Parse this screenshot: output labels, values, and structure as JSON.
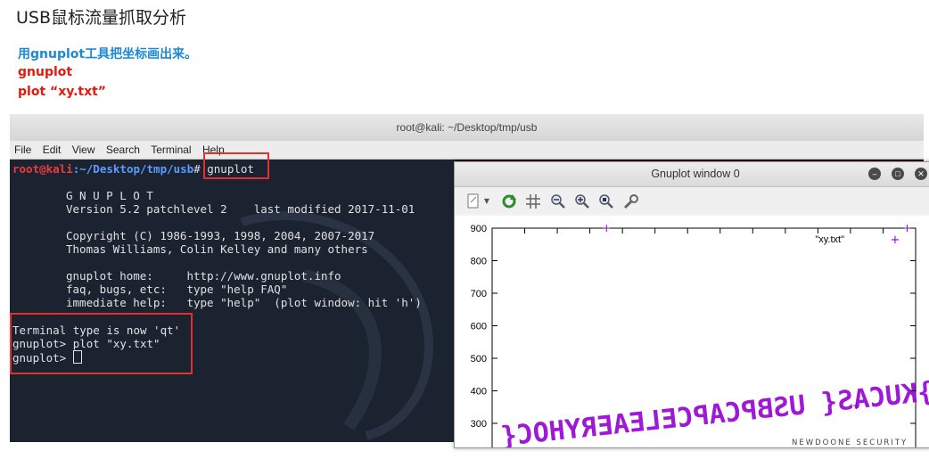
{
  "slide": {
    "title": "USB鼠标流量抓取分析",
    "note_blue": "用gnuplot工具把坐标画出来。",
    "note_cmd1": "gnuplot",
    "note_cmd2": "plot “xy.txt”"
  },
  "terminal": {
    "title": "root@kali: ~/Desktop/tmp/usb",
    "menu": [
      "File",
      "Edit",
      "View",
      "Search",
      "Terminal",
      "Help"
    ],
    "prompt_user": "root@kali",
    "prompt_path": ":~/Desktop/tmp/usb",
    "prompt_symbol": "#",
    "first_command": " gnuplot",
    "banner": [
      "G N U P L O T",
      "Version 5.2 patchlevel 2    last modified 2017-11-01",
      "",
      "Copyright (C) 1986-1993, 1998, 2004, 2007-2017",
      "Thomas Williams, Colin Kelley and many others",
      "",
      "gnuplot home:     http://www.gnuplot.info",
      "faq, bugs, etc:   type \"help FAQ\"",
      "immediate help:   type \"help\"  (plot window: hit 'h')"
    ],
    "session": [
      "Terminal type is now 'qt'",
      "gnuplot> plot \"xy.txt\"",
      "gnuplot> "
    ]
  },
  "gnuplot_window": {
    "title": "Gnuplot window 0",
    "toolbar_icons": [
      "export-icon",
      "replot-icon",
      "grid-icon",
      "zoom-out-icon",
      "zoom-in-icon",
      "zoom-fit-icon",
      "settings-icon"
    ],
    "window_buttons": [
      "minimize-icon",
      "maximize-icon",
      "close-icon"
    ]
  },
  "chart_data": {
    "type": "scatter",
    "series": [
      {
        "name": "\"xy.txt\"",
        "marker": "+",
        "color": "#9400d3"
      }
    ],
    "y_ticks": [
      300,
      400,
      500,
      600,
      700,
      800,
      900
    ],
    "ylim": [
      260,
      900
    ],
    "x_ticks_shown": false,
    "legend": "top-right",
    "visible_points": [
      {
        "x": 0.27,
        "y": 900
      },
      {
        "x": 0.98,
        "y": 900
      },
      {
        "x": 0.86,
        "y": 355
      }
    ],
    "drawn_text_in_points": "}KUCAS{ USBPCAPCELEAERYHOC{"
  },
  "watermark": "NEWDOONE SECURITY"
}
